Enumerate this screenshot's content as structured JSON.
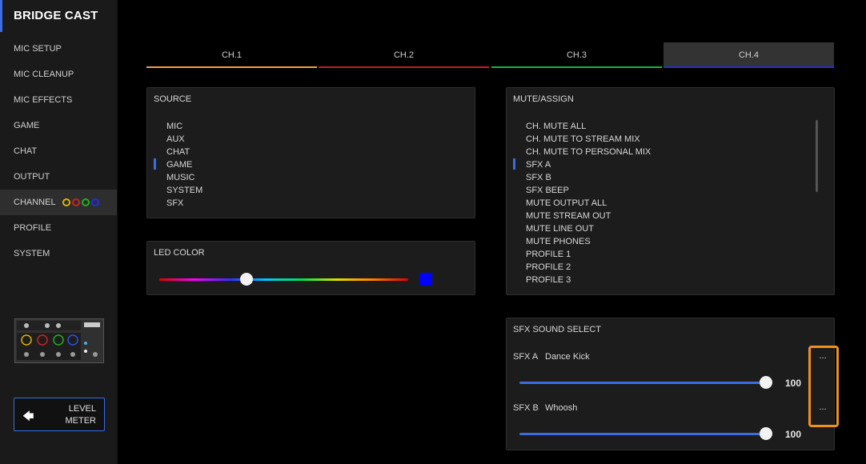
{
  "app": {
    "title": "BRIDGE CAST"
  },
  "sidebar": {
    "items": [
      {
        "label": "MIC SETUP"
      },
      {
        "label": "MIC CLEANUP"
      },
      {
        "label": "MIC EFFECTS"
      },
      {
        "label": "GAME"
      },
      {
        "label": "CHAT"
      },
      {
        "label": "OUTPUT"
      },
      {
        "label": "CHANNEL",
        "active": true,
        "circle_colors": [
          "#e0b000",
          "#d02020",
          "#20b020",
          "#2030e0"
        ]
      },
      {
        "label": "PROFILE"
      },
      {
        "label": "SYSTEM"
      }
    ],
    "level_meter_label": "LEVEL\nMETER",
    "level_meter_icon": "arrow-left-icon"
  },
  "tabs": [
    {
      "label": "CH.1",
      "color": "#f0a040"
    },
    {
      "label": "CH.2",
      "color": "#c02020"
    },
    {
      "label": "CH.3",
      "color": "#20b040"
    },
    {
      "label": "CH.4",
      "color": "#2030d0",
      "active": true
    }
  ],
  "source": {
    "title": "SOURCE",
    "items": [
      "MIC",
      "AUX",
      "CHAT",
      "GAME",
      "MUSIC",
      "SYSTEM",
      "SFX"
    ],
    "selected": "GAME"
  },
  "led_color": {
    "title": "LED COLOR",
    "position": 0.35,
    "swatch_color": "#0000ff"
  },
  "mute_assign": {
    "title": "MUTE/ASSIGN",
    "items": [
      "CH. MUTE ALL",
      "CH. MUTE TO STREAM MIX",
      "CH. MUTE TO PERSONAL MIX",
      "SFX A",
      "SFX B",
      "SFX BEEP",
      "MUTE OUTPUT ALL",
      "MUTE STREAM OUT",
      "MUTE LINE OUT",
      "MUTE PHONES",
      "PROFILE 1",
      "PROFILE 2",
      "PROFILE 3"
    ],
    "selected": "SFX A"
  },
  "sfx_select": {
    "title": "SFX SOUND SELECT",
    "slots": [
      {
        "slot": "SFX A",
        "sound": "Dance Kick",
        "value": "100",
        "more_label": "..."
      },
      {
        "slot": "SFX B",
        "sound": "Whoosh",
        "value": "100",
        "more_label": "..."
      }
    ]
  },
  "colors": {
    "accent": "#3b6de0",
    "highlight": "#f0901e"
  }
}
